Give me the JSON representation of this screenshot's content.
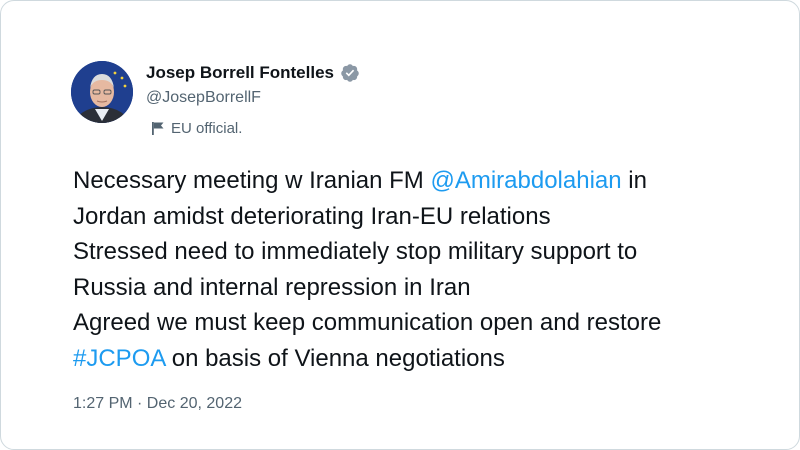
{
  "author": {
    "display_name": "Josep Borrell Fontelles",
    "handle": "@JosepBorrellF",
    "label": "EU official.",
    "verified_icon": "verified-badge-icon",
    "label_icon": "flag-icon"
  },
  "tweet": {
    "lines": [
      {
        "before": "Necessary meeting w Iranian FM ",
        "mention": "@Amirabdolahian",
        "after": " in"
      },
      {
        "text": "Jordan amidst deteriorating Iran-EU relations"
      },
      {
        "text": "Stressed need to immediately stop military support to"
      },
      {
        "text": "Russia and internal repression in Iran"
      },
      {
        "text": "Agreed we must keep communication open and restore"
      },
      {
        "hashtag": "#JCPOA",
        "after": " on basis of Vienna negotiations"
      }
    ]
  },
  "meta": {
    "timestamp": "1:27 PM · Dec 20, 2022"
  },
  "colors": {
    "link": "#1d9bf0",
    "text": "#0f1419",
    "secondary": "#536471"
  }
}
